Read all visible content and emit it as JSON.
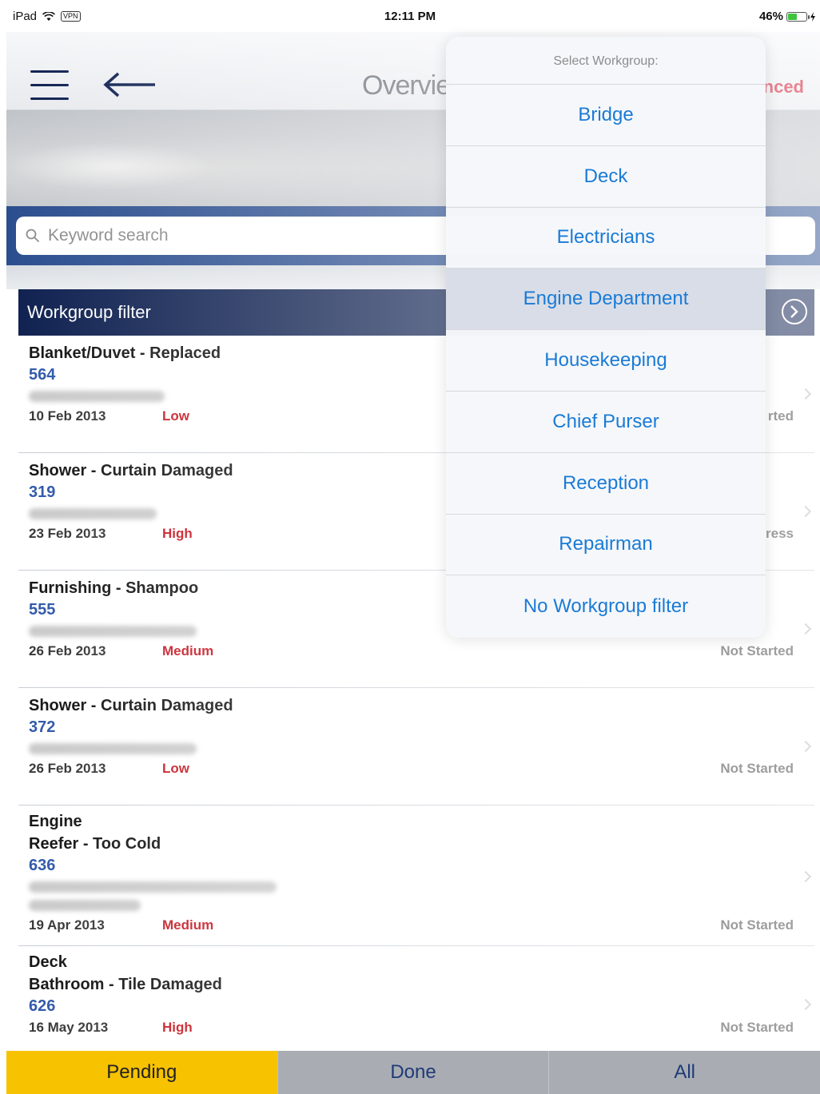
{
  "status_bar": {
    "device": "iPad",
    "vpn": "VPN",
    "time": "12:11 PM",
    "battery": "46%",
    "battery_level": 0.46
  },
  "nav": {
    "title": "Overvie",
    "right_text": "nced"
  },
  "search": {
    "placeholder": "Keyword search"
  },
  "workgroup_filter": {
    "label": "Workgroup filter"
  },
  "popover": {
    "title": "Select Workgroup:",
    "options": [
      {
        "label": "Bridge"
      },
      {
        "label": "Deck"
      },
      {
        "label": "Electricians"
      },
      {
        "label": "Engine Department",
        "selected": true
      },
      {
        "label": "Housekeeping"
      },
      {
        "label": "Chief Purser"
      },
      {
        "label": "Reception"
      },
      {
        "label": "Repairman"
      },
      {
        "label": "No Workgroup filter"
      }
    ]
  },
  "rows": [
    {
      "title": "Blanket/Duvet - Replaced",
      "number": "564",
      "date": "10 Feb 2013",
      "priority": "Low",
      "status": "rted"
    },
    {
      "title": "Shower - Curtain Damaged",
      "number": "319",
      "date": "23 Feb 2013",
      "priority": "High",
      "status": "ress"
    },
    {
      "title": "Furnishing - Shampoo",
      "number": "555",
      "date": "26 Feb 2013",
      "priority": "Medium",
      "status": "Not Started"
    },
    {
      "title": "Shower - Curtain Damaged",
      "number": "372",
      "date": "26 Feb 2013",
      "priority": "Low",
      "status": "Not Started"
    },
    {
      "group": "Engine",
      "title": "Reefer - Too Cold",
      "number": "636",
      "date": "19 Apr 2013",
      "priority": "Medium",
      "status": "Not Started"
    },
    {
      "group": "Deck",
      "title": "Bathroom - Tile Damaged",
      "number": "626",
      "date": "16 May 2013",
      "priority": "High",
      "status": "Not Started"
    }
  ],
  "tabs": [
    {
      "label": "Pending",
      "active": true
    },
    {
      "label": "Done"
    },
    {
      "label": "All"
    }
  ]
}
